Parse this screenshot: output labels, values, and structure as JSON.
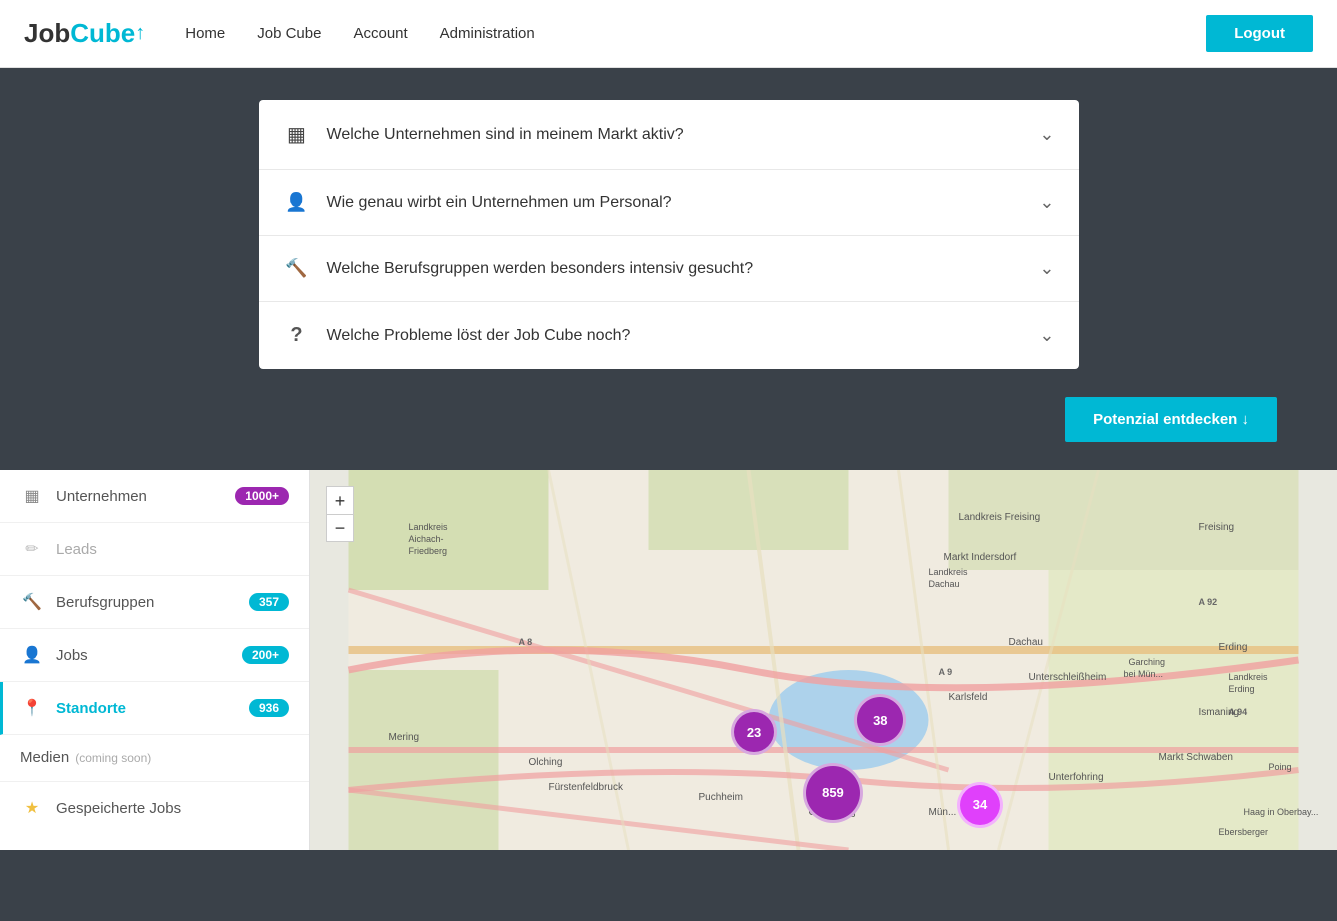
{
  "header": {
    "logo_job": "Job",
    "logo_cube": "Cube",
    "logo_cursor": "↑",
    "nav": [
      {
        "id": "home",
        "label": "Home"
      },
      {
        "id": "job-cube",
        "label": "Job Cube"
      },
      {
        "id": "account",
        "label": "Account"
      },
      {
        "id": "administration",
        "label": "Administration"
      }
    ],
    "logout_label": "Logout"
  },
  "accordion": {
    "items": [
      {
        "id": "item1",
        "icon": "▦",
        "title": "Welche Unternehmen sind in meinem Markt aktiv?"
      },
      {
        "id": "item2",
        "icon": "👤",
        "title": "Wie genau wirbt ein Unternehmen um Personal?"
      },
      {
        "id": "item3",
        "icon": "🔨",
        "title": "Welche Berufsgruppen werden besonders intensiv gesucht?"
      },
      {
        "id": "item4",
        "icon": "?",
        "title": "Welche Probleme löst der Job Cube noch?"
      }
    ]
  },
  "potenzial_button": "Potenzial entdecken ↓",
  "sidebar": {
    "items": [
      {
        "id": "unternehmen",
        "icon": "▦",
        "label": "Unternehmen",
        "badge": "1000+",
        "badge_type": "purple",
        "active": false
      },
      {
        "id": "leads",
        "icon": "✏",
        "label": "Leads",
        "badge": "",
        "badge_type": "",
        "active": false,
        "muted": true
      },
      {
        "id": "berufsgruppen",
        "icon": "🔨",
        "label": "Berufsgruppen",
        "badge": "357",
        "badge_type": "teal",
        "active": false
      },
      {
        "id": "jobs",
        "icon": "👤",
        "label": "Jobs",
        "badge": "200+",
        "badge_type": "teal",
        "active": false
      },
      {
        "id": "standorte",
        "icon": "📍",
        "label": "Standorte",
        "badge": "936",
        "badge_type": "teal",
        "active": true
      }
    ],
    "medien_label": "Medien",
    "coming_soon_label": "(coming soon)",
    "saved_jobs_label": "Gespeicherte Jobs"
  },
  "map": {
    "clusters": [
      {
        "id": "c1",
        "label": "23",
        "size": 46,
        "top": "65%",
        "left": "43%",
        "type": "purple"
      },
      {
        "id": "c2",
        "label": "38",
        "size": 52,
        "top": "62%",
        "left": "56%",
        "type": "purple"
      },
      {
        "id": "c3",
        "label": "859",
        "size": 60,
        "top": "80%",
        "left": "50%",
        "type": "purple"
      },
      {
        "id": "c4",
        "label": "34",
        "size": 46,
        "top": "82%",
        "left": "67%",
        "type": "pink"
      }
    ]
  }
}
